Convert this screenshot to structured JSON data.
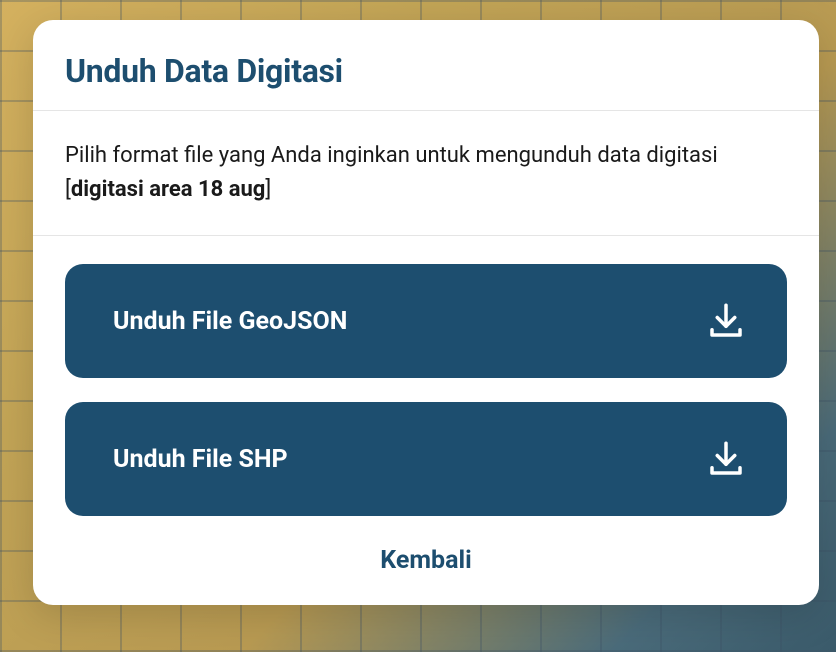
{
  "modal": {
    "title": "Unduh Data Digitasi",
    "description_prefix": "Pilih format file yang Anda inginkan untuk mengunduh data digitasi [",
    "description_strong": "digitasi area 18 aug",
    "description_suffix": "]",
    "buttons": {
      "geojson_label": "Unduh File GeoJSON",
      "shp_label": "Unduh File SHP"
    },
    "back_label": "Kembali"
  },
  "colors": {
    "primary": "#1d4e6f",
    "white": "#ffffff"
  }
}
